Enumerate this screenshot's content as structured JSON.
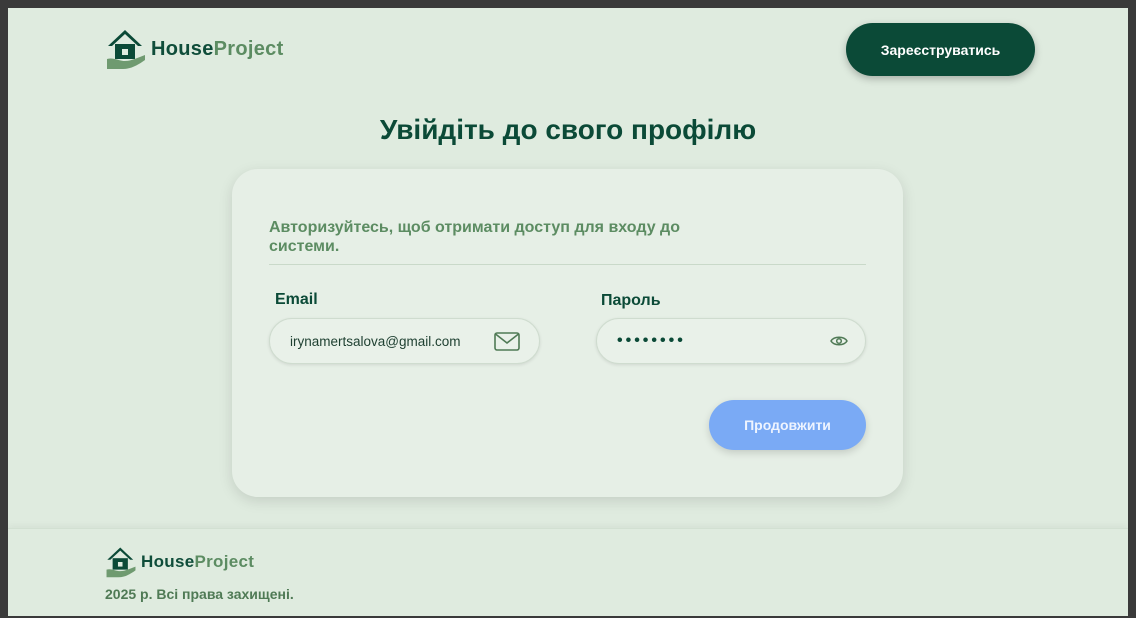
{
  "brand": {
    "name_dark": "House",
    "name_light": "Project"
  },
  "header": {
    "register_label": "Зареєструватись"
  },
  "login": {
    "title": "Увійдіть до свого профілю",
    "subtitle": "Авторизуйтесь, щоб отримати доступ для входу до системи.",
    "email_label": "Email",
    "email_value": "irynamertsalova@gmail.com",
    "password_label": "Пароль",
    "password_masked": "••••••••",
    "continue_label": "Продовжити"
  },
  "footer": {
    "copyright": "2025 р. Всі права захищені."
  },
  "colors": {
    "background": "#dfebdf",
    "primary": "#0b4a37",
    "accent_green": "#5c8c62",
    "button_blue": "#7aaaf5"
  },
  "icons": {
    "logo": "house-hand-icon",
    "email": "envelope-icon",
    "password": "eye-icon"
  }
}
